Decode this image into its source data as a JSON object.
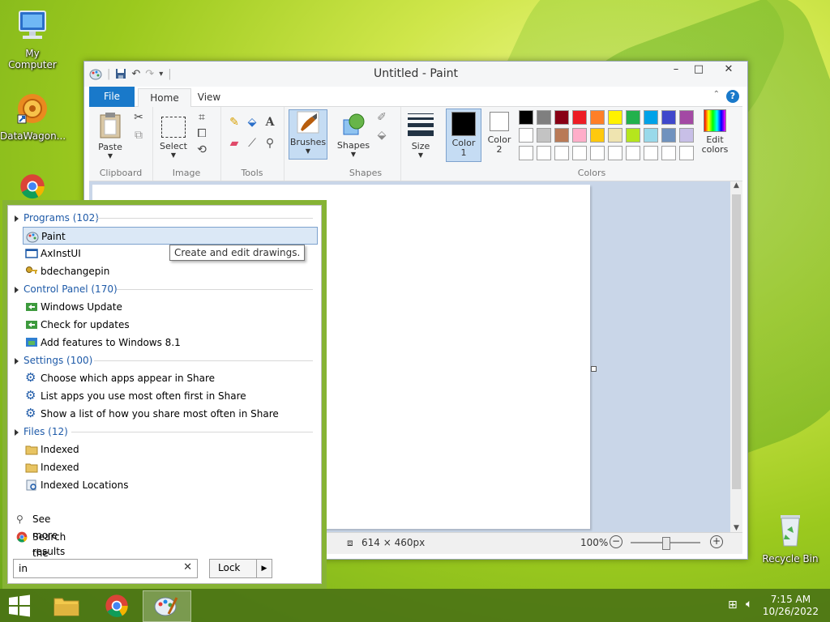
{
  "desktop": {
    "icons": [
      {
        "label": "My Computer"
      },
      {
        "label": "DataWagon..."
      },
      {
        "label": "Recycle Bin"
      }
    ]
  },
  "paint": {
    "title": "Untitled - Paint",
    "tabs": {
      "file": "File",
      "home": "Home",
      "view": "View"
    },
    "groups": {
      "clipboard": {
        "label": "Clipboard",
        "paste": "Paste"
      },
      "image": {
        "label": "Image",
        "select": "Select"
      },
      "tools": {
        "label": "Tools"
      },
      "brushes": {
        "label": "Brushes"
      },
      "shapes": {
        "label": "Shapes",
        "shapes_btn": "Shapes"
      },
      "size": {
        "label": "Size"
      },
      "colors": {
        "label": "Colors",
        "color1": "Color\n1",
        "color2": "Color\n2",
        "edit": "Edit\ncolors"
      }
    },
    "palette_row1": [
      "#000000",
      "#7f7f7f",
      "#880015",
      "#ed1c24",
      "#ff7f27",
      "#fff200",
      "#22b14c",
      "#00a2e8",
      "#3f48cc",
      "#a349a4"
    ],
    "palette_row2": [
      "#ffffff",
      "#c3c3c3",
      "#b97a57",
      "#ffaec9",
      "#ffc90e",
      "#efe4b0",
      "#b5e61d",
      "#99d9ea",
      "#7092be",
      "#c8bfe7"
    ],
    "status": {
      "size": "614 × 460px",
      "zoom": "100%"
    }
  },
  "search": {
    "categories": [
      {
        "label": "Programs (102)"
      },
      {
        "label": "Control Panel (170)"
      },
      {
        "label": "Settings (100)"
      },
      {
        "label": "Files (12)"
      }
    ],
    "programs": [
      "Paint",
      "AxInstUI",
      "bdechangepin"
    ],
    "control_panel": [
      "Windows Update",
      "Check for updates",
      "Add features to Windows 8.1"
    ],
    "settings": [
      "Choose which apps appear in Share",
      "List apps you use most often first in Share",
      "Show a list of how you share most often in Share"
    ],
    "files": [
      "Indexed",
      "Indexed",
      "Indexed Locations"
    ],
    "tooltip": "Create and edit drawings.",
    "see_more": "See more results",
    "search_internet": "Search the Internet",
    "query": "in",
    "lock": "Lock"
  },
  "taskbar": {
    "time": "7:15 AM",
    "date": "10/26/2022"
  }
}
